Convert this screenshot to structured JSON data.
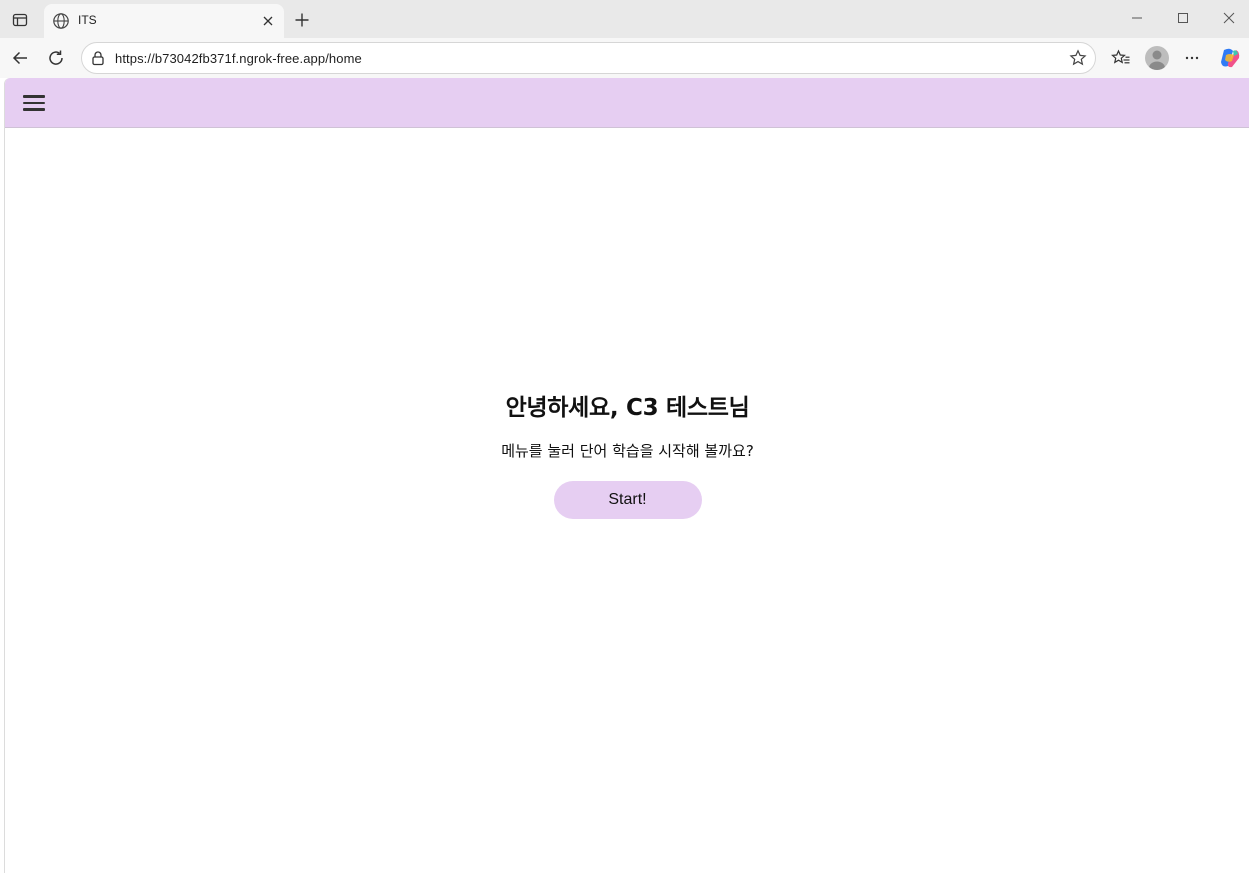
{
  "browser": {
    "tab": {
      "title": "ITS",
      "favicon": "globe-icon"
    },
    "address": {
      "url": "https://b73042fb371f.ngrok-free.app/home"
    },
    "icons": [
      "tab-actions-icon",
      "close-icon",
      "plus-icon",
      "minimize-icon",
      "maximize-icon",
      "window-close-icon",
      "back-icon",
      "refresh-icon",
      "lock-icon",
      "star-icon",
      "favorites-icon",
      "profile-icon",
      "more-icon",
      "copilot-icon"
    ]
  },
  "app": {
    "header": {
      "menu_icon": "hamburger-menu-icon",
      "background": "#e6cef2"
    },
    "greeting": "안녕하세요, C3 테스트님",
    "subtitle": "메뉴를 눌러 단어 학습을 시작해 볼까요?",
    "start_label": "Start!",
    "accent": "#e6cef2"
  }
}
